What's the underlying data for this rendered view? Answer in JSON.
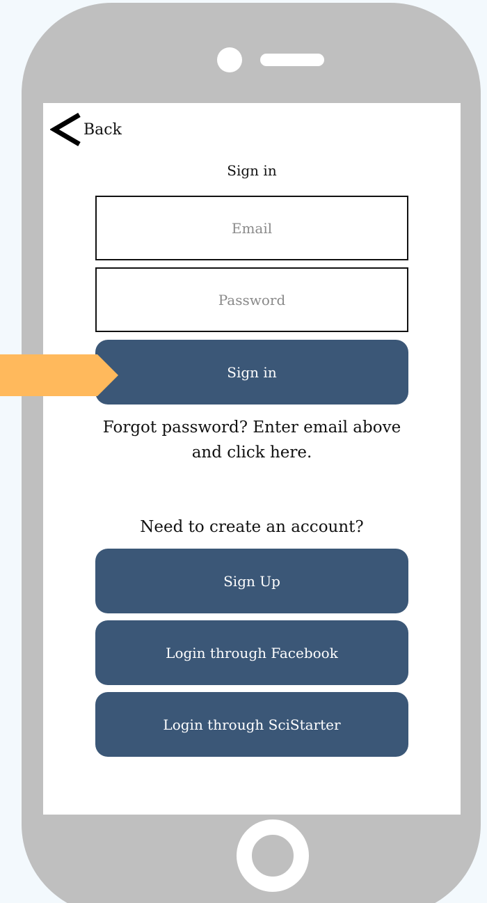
{
  "nav": {
    "back_label": "Back"
  },
  "signin": {
    "title": "Sign in",
    "email_placeholder": "Email",
    "password_placeholder": "Password",
    "button_label": "Sign in",
    "forgot_text": "Forgot password? Enter email above and click here."
  },
  "account": {
    "prompt": "Need to create an account?",
    "signup_label": "Sign Up",
    "facebook_label": "Login through Facebook",
    "scistarter_label": "Login through SciStarter"
  },
  "colors": {
    "button": "#3b5777",
    "phone_frame": "#bfbfbf",
    "highlight_arrow": "#ffb95c",
    "background": "#f3f9fd"
  },
  "icons": {
    "back": "chevron-left-icon",
    "highlight": "arrow-right-icon"
  }
}
